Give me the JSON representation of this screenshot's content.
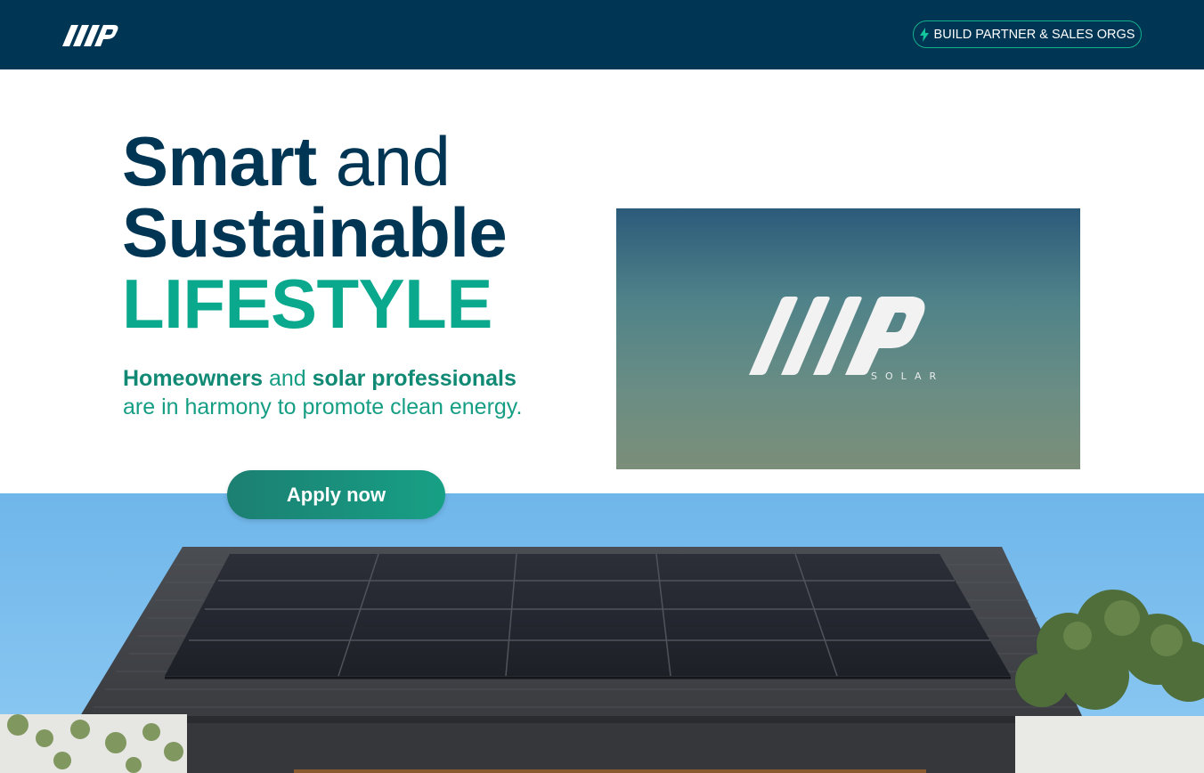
{
  "nav": {
    "logo_icon": "wp-logo-icon",
    "cta_icon": "lightning-icon",
    "cta_label": "BUILD PARTNER & SALES ORGS"
  },
  "hero": {
    "title_word1": "Smart",
    "title_word2": "and",
    "title_line2": "Sustainable",
    "title_line3": "LIFESTYLE",
    "sub_strong1": "Homeowners",
    "sub_mid": "and",
    "sub_strong2": "solar professionals",
    "sub_rest": "are in harmony to promote clean energy.",
    "apply_label": "Apply now"
  },
  "brand_card": {
    "logo_icon": "wp-solar-logo",
    "wordmark": "SOLAR"
  },
  "photo": {
    "description_icon": "house-solar-roof-photo"
  },
  "colors": {
    "navy": "#003554",
    "accent": "#0aa88d",
    "button_start": "#1c7f72",
    "button_end": "#17a085"
  }
}
